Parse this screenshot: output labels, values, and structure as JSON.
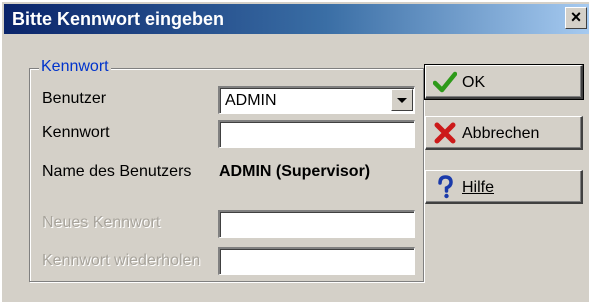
{
  "window": {
    "title": "Bitte Kennwort eingeben",
    "close_glyph": "×"
  },
  "group": {
    "legend": "Kennwort"
  },
  "form": {
    "user_label": "Benutzer",
    "user_value": "ADMIN",
    "password_label": "Kennwort",
    "password_value": "",
    "username_label": "Name des Benutzers",
    "username_value": "ADMIN (Supervisor)",
    "new_password_label": "Neues Kennwort",
    "new_password_value": "",
    "repeat_password_label": "Kennwort wiederholen",
    "repeat_password_value": ""
  },
  "buttons": {
    "ok_label": "OK",
    "cancel_label": "Abbrechen",
    "help_label": "Hilfe"
  },
  "colors": {
    "title_start": "#0a246a",
    "title_end": "#a6caf0",
    "dialog_bg": "#d4d0c8",
    "legend_text": "#0033cc",
    "ok_icon": "#2e9a1a",
    "cancel_icon": "#cc1a1a",
    "help_icon": "#1a3aaa"
  },
  "icons": {
    "ok": "checkmark-icon",
    "cancel": "cross-icon",
    "help": "question-mark-icon",
    "dropdown": "chevron-down-icon"
  }
}
